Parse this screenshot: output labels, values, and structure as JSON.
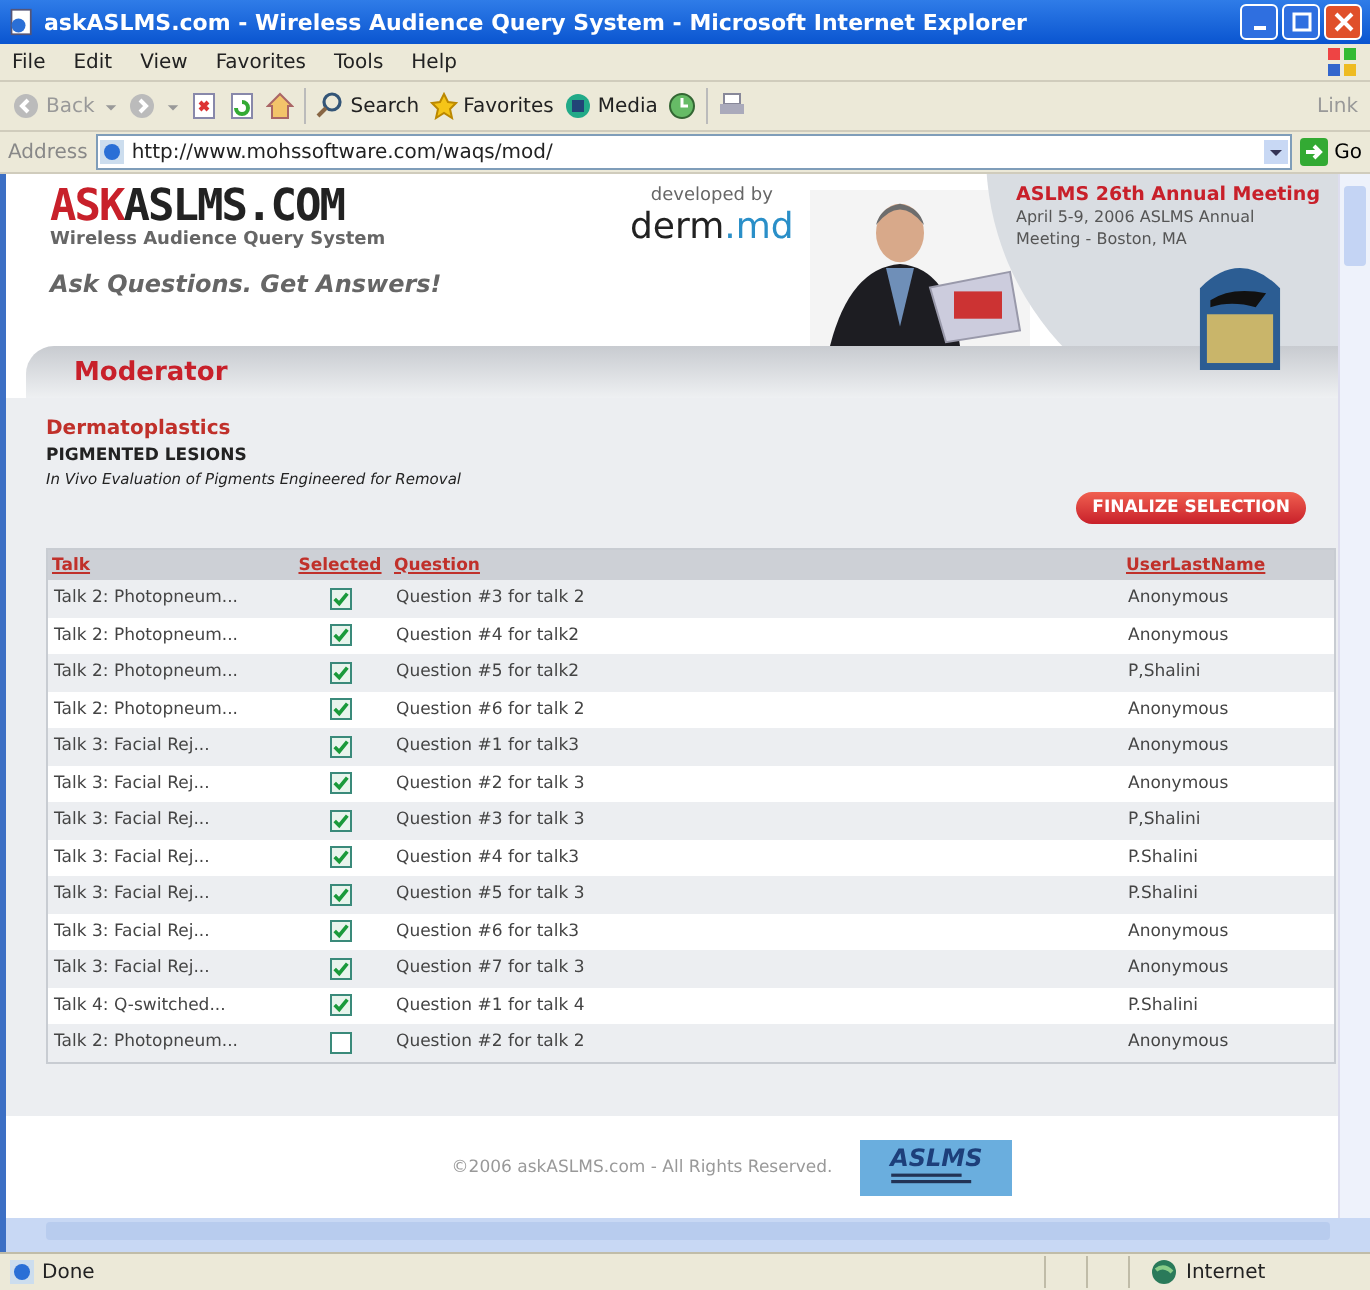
{
  "window": {
    "title": "askASLMS.com - Wireless Audience Query System - Microsoft Internet Explorer"
  },
  "menu": [
    "File",
    "Edit",
    "View",
    "Favorites",
    "Tools",
    "Help"
  ],
  "toolbar": {
    "back": "Back",
    "search": "Search",
    "favorites": "Favorites",
    "media": "Media",
    "links": "Link"
  },
  "address": {
    "label": "Address",
    "value": "http://www.mohssoftware.com/waqs/mod/",
    "go": "Go"
  },
  "header": {
    "logo_accent": "ASK",
    "logo_rest": "ASLMS.COM",
    "subtitle": "Wireless Audience Query System",
    "tagline": "Ask Questions. Get Answers!",
    "developed_by": "developed by",
    "dev_logo_a": "derm",
    "dev_logo_b": ".md",
    "meeting_title": "ASLMS 26th Annual Meeting",
    "meeting_details": "April 5-9, 2006 ASLMS Annual Meeting - Boston, MA"
  },
  "section": "Moderator",
  "category": "Dermatoplastics",
  "topic": "PIGMENTED LESIONS",
  "talk_title": "In Vivo Evaluation of Pigments Engineered for Removal",
  "finalize_button": "FINALIZE SELECTION",
  "table": {
    "columns": [
      "Talk",
      "Selected",
      "Question",
      "UserLastName"
    ],
    "rows": [
      {
        "talk": "Talk 2: Photopneum...",
        "selected": true,
        "question": "Question #3 for talk 2",
        "user": "Anonymous"
      },
      {
        "talk": "Talk 2: Photopneum...",
        "selected": true,
        "question": "Question #4 for talk2",
        "user": "Anonymous"
      },
      {
        "talk": "Talk 2: Photopneum...",
        "selected": true,
        "question": "Question #5 for talk2",
        "user": "P,Shalini"
      },
      {
        "talk": "Talk 2: Photopneum...",
        "selected": true,
        "question": "Question #6 for talk 2",
        "user": "Anonymous"
      },
      {
        "talk": "Talk 3: Facial Rej...",
        "selected": true,
        "question": "Question #1 for talk3",
        "user": "Anonymous"
      },
      {
        "talk": "Talk 3: Facial Rej...",
        "selected": true,
        "question": "Question #2 for talk 3",
        "user": "Anonymous"
      },
      {
        "talk": "Talk 3: Facial Rej...",
        "selected": true,
        "question": "Question #3 for talk 3",
        "user": "P,Shalini"
      },
      {
        "talk": "Talk 3: Facial Rej...",
        "selected": true,
        "question": "Question #4 for talk3",
        "user": "P.Shalini"
      },
      {
        "talk": "Talk 3: Facial Rej...",
        "selected": true,
        "question": "Question #5 for talk 3",
        "user": "P.Shalini"
      },
      {
        "talk": "Talk 3: Facial Rej...",
        "selected": true,
        "question": "Question #6 for talk3",
        "user": "Anonymous"
      },
      {
        "talk": "Talk 3: Facial Rej...",
        "selected": true,
        "question": "Question #7 for talk 3",
        "user": "Anonymous"
      },
      {
        "talk": "Talk 4: Q-switched...",
        "selected": true,
        "question": "Question #1 for talk 4",
        "user": "P.Shalini"
      },
      {
        "talk": "Talk 2: Photopneum...",
        "selected": false,
        "question": "Question #2 for talk 2",
        "user": "Anonymous"
      }
    ]
  },
  "footer": {
    "copyright": "©2006 askASLMS.com - All Rights Reserved.",
    "badge": "ASLMS"
  },
  "status_bar": {
    "status": "Done",
    "zone": "Internet"
  }
}
